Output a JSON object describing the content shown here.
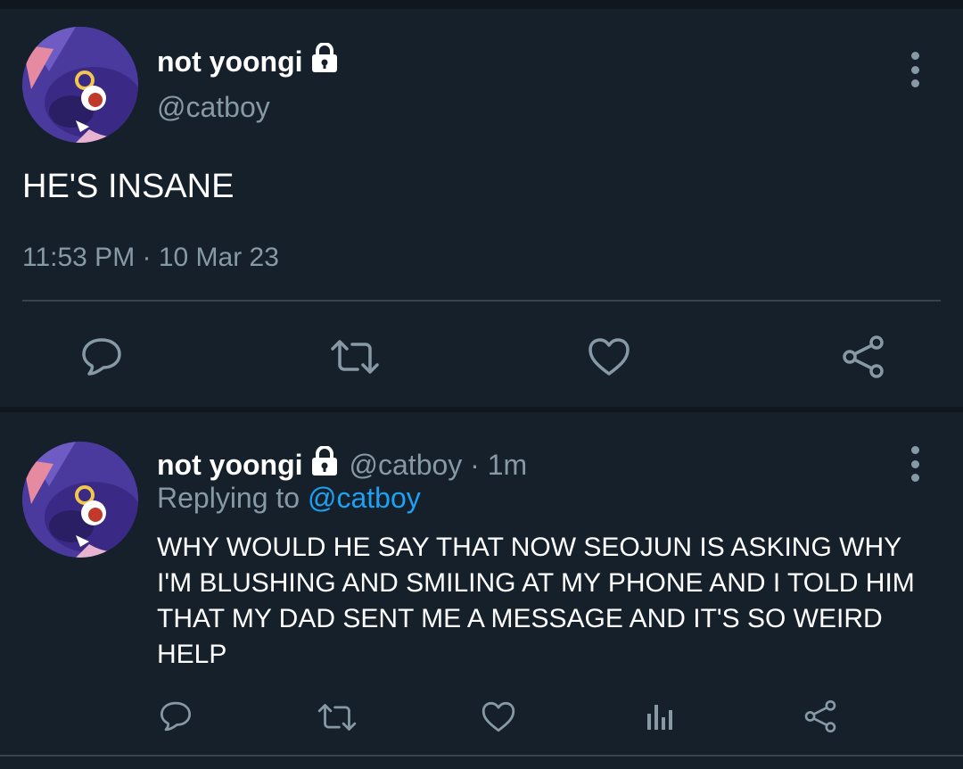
{
  "main_tweet": {
    "display_name": "not yoongi",
    "handle": "@catboy",
    "text": "HE'S INSANE",
    "timestamp": "11:53 PM · 10 Mar 23"
  },
  "reply_tweet": {
    "display_name": "not yoongi",
    "handle_time": "@catboy · 1m",
    "replying_prefix": "Replying to",
    "replying_to": "@catboy",
    "text": "WHY WOULD HE SAY THAT NOW SEOJUN IS ASKING WHY I'M BLUSHING AND SMILING AT MY PHONE AND I TOLD HIM THAT MY DAD SENT ME A MESSAGE AND IT'S SO WEIRD HELP"
  },
  "icons": [
    "lock-icon",
    "more-icon",
    "reply-icon",
    "retweet-icon",
    "like-icon",
    "share-icon",
    "analytics-icon"
  ],
  "colors": {
    "background": "#15202b",
    "secondary_text": "#8899a6",
    "link": "#1da1f2",
    "divider": "#38444d"
  }
}
